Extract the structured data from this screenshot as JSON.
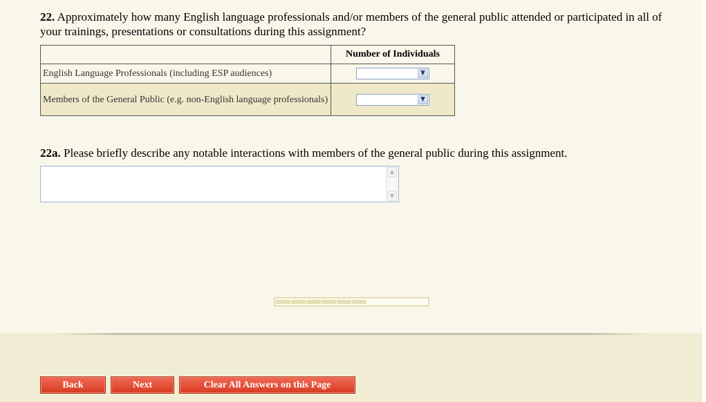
{
  "question22": {
    "number": "22.",
    "text": "Approximately how many English language professionals and/or members of the general public attended or participated in all of your trainings, presentations or consultations during this assignment?"
  },
  "table": {
    "column_header": "Number of Individuals",
    "rows": [
      {
        "label": "English Language Professionals (including ESP audiences)",
        "selected": ""
      },
      {
        "label": "Members of the General Public (e.g. non-English language professionals)",
        "selected": ""
      }
    ]
  },
  "question22a": {
    "number": "22a.",
    "text": "Please briefly describe any notable interactions with members of the general public during this assignment.",
    "value": ""
  },
  "progress": {
    "segments_filled": 6,
    "fraction": 0.6
  },
  "buttons": {
    "back": "Back",
    "next": "Next",
    "clear": "Clear All Answers on this Page"
  },
  "icons": {
    "dropdown": "chevron-down-icon",
    "scroll_up": "scroll-up-icon",
    "scroll_down": "scroll-down-icon"
  },
  "colors": {
    "background": "#f9f7ea",
    "row_alt": "#efe9c9",
    "button": "#e0482f",
    "footer": "#f1ecd4"
  }
}
